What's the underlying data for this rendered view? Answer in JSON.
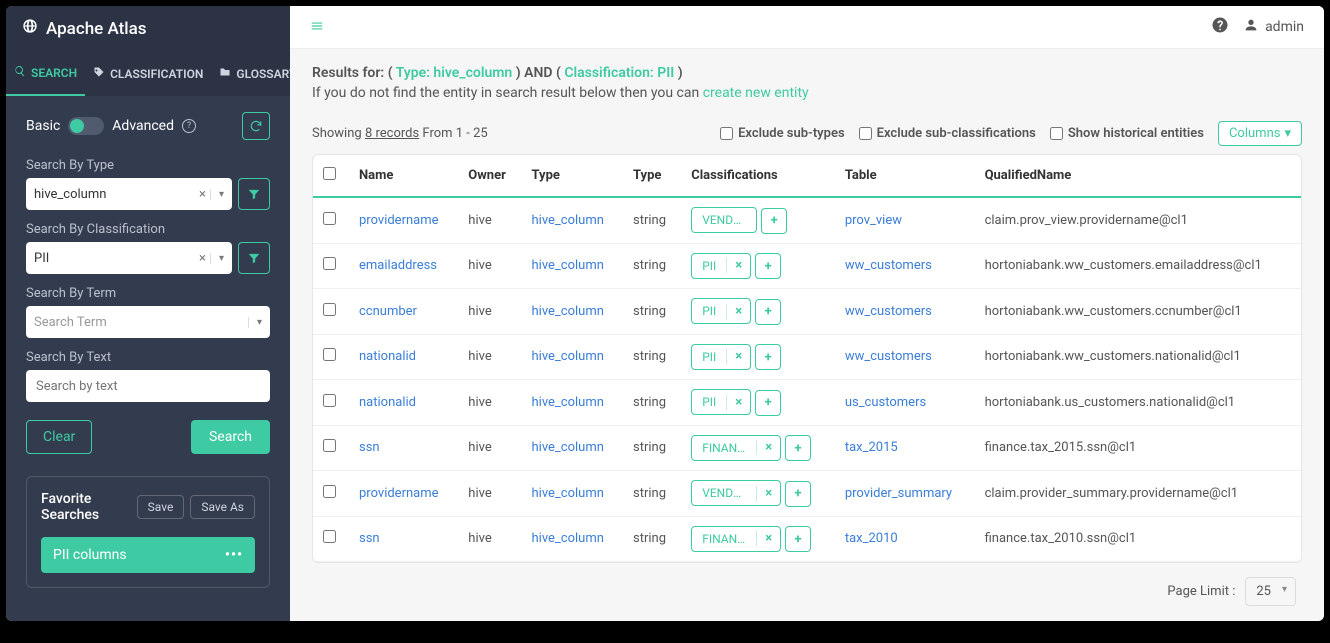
{
  "brand": "Apache Atlas",
  "tabs": {
    "search": "SEARCH",
    "classification": "CLASSIFICATION",
    "glossary": "GLOSSARY"
  },
  "mode": {
    "basic": "Basic",
    "advanced": "Advanced"
  },
  "fields": {
    "type_label": "Search By Type",
    "type_value": "hive_column",
    "class_label": "Search By Classification",
    "class_value": "PII",
    "term_label": "Search By Term",
    "term_placeholder": "Search Term",
    "text_label": "Search By Text",
    "text_placeholder": "Search by text"
  },
  "buttons": {
    "clear": "Clear",
    "search": "Search",
    "save": "Save",
    "save_as": "Save As",
    "columns": "Columns"
  },
  "favorites": {
    "title": "Favorite Searches",
    "items": [
      "PII columns"
    ]
  },
  "topbar": {
    "user": "admin"
  },
  "results": {
    "prefix": "Results for: ( ",
    "type_label": "Type: hive_column",
    "mid": " ) AND ( ",
    "class_label": "Classification: PII",
    "suffix": " )",
    "hint_prefix": "If you do not find the entity in search result below then you can ",
    "hint_link": "create new entity",
    "showing_1": "Showing ",
    "showing_count": "8 records",
    "showing_2": " From 1 - 25"
  },
  "filters": {
    "ex_sub": "Exclude sub-types",
    "ex_class": "Exclude sub-classifications",
    "hist": "Show historical entities"
  },
  "columns": [
    "Name",
    "Owner",
    "Type",
    "Type",
    "Classifications",
    "Table",
    "QualifiedName"
  ],
  "rows": [
    {
      "name": "providername",
      "owner": "hive",
      "type1": "hive_column",
      "type2": "string",
      "tag": "VENDOR_PII",
      "tag_removable": false,
      "table": "prov_view",
      "qn": "claim.prov_view.providername@cl1"
    },
    {
      "name": "emailaddress",
      "owner": "hive",
      "type1": "hive_column",
      "type2": "string",
      "tag": "PII",
      "tag_removable": true,
      "table": "ww_customers",
      "qn": "hortoniabank.ww_customers.emailaddress@cl1"
    },
    {
      "name": "ccnumber",
      "owner": "hive",
      "type1": "hive_column",
      "type2": "string",
      "tag": "PII",
      "tag_removable": true,
      "table": "ww_customers",
      "qn": "hortoniabank.ww_customers.ccnumber@cl1"
    },
    {
      "name": "nationalid",
      "owner": "hive",
      "type1": "hive_column",
      "type2": "string",
      "tag": "PII",
      "tag_removable": true,
      "table": "ww_customers",
      "qn": "hortoniabank.ww_customers.nationalid@cl1"
    },
    {
      "name": "nationalid",
      "owner": "hive",
      "type1": "hive_column",
      "type2": "string",
      "tag": "PII",
      "tag_removable": true,
      "table": "us_customers",
      "qn": "hortoniabank.us_customers.nationalid@cl1"
    },
    {
      "name": "ssn",
      "owner": "hive",
      "type1": "hive_column",
      "type2": "string",
      "tag": "FINANCE…",
      "tag_removable": true,
      "table": "tax_2015",
      "qn": "finance.tax_2015.ssn@cl1"
    },
    {
      "name": "providername",
      "owner": "hive",
      "type1": "hive_column",
      "type2": "string",
      "tag": "VENDOR…",
      "tag_removable": true,
      "table": "provider_summary",
      "qn": "claim.provider_summary.providername@cl1"
    },
    {
      "name": "ssn",
      "owner": "hive",
      "type1": "hive_column",
      "type2": "string",
      "tag": "FINANCE…",
      "tag_removable": true,
      "table": "tax_2010",
      "qn": "finance.tax_2010.ssn@cl1"
    }
  ],
  "footer": {
    "label": "Page Limit :",
    "value": "25"
  }
}
